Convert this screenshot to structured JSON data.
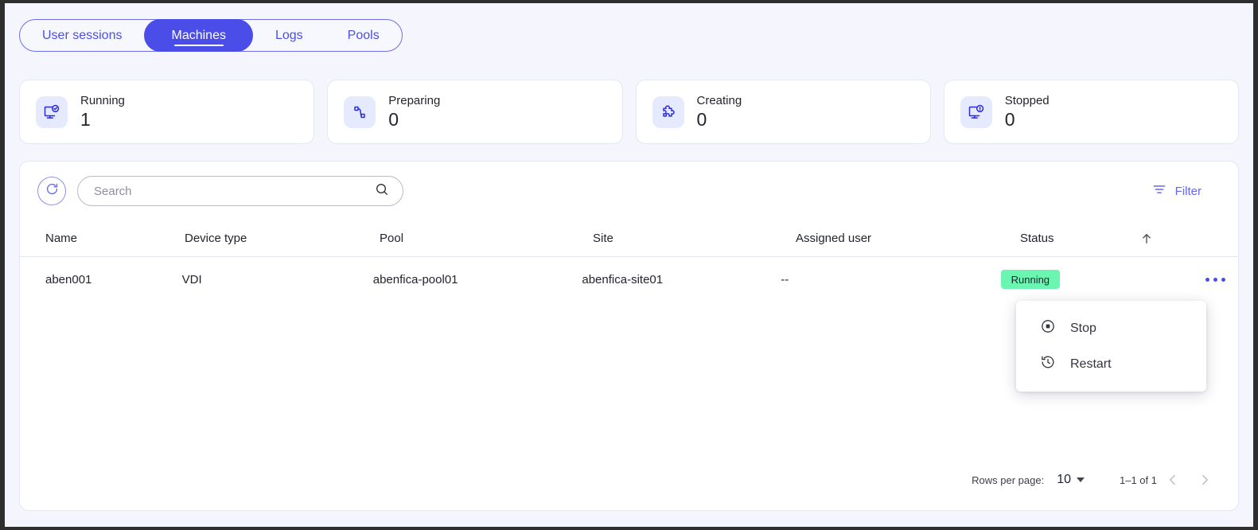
{
  "theme": {
    "accent": "#4b4de8",
    "accent_light": "#6568ef",
    "page_bg": "#f4f5fd",
    "card_bg": "#ffffff",
    "badge_running_bg": "#6af5b0",
    "icon_tile_bg": "#e6eaff"
  },
  "tabs": [
    {
      "label": "User sessions",
      "active": false,
      "name": "tab-user-sessions"
    },
    {
      "label": "Machines",
      "active": true,
      "name": "tab-machines"
    },
    {
      "label": "Logs",
      "active": false,
      "name": "tab-logs"
    },
    {
      "label": "Pools",
      "active": false,
      "name": "tab-pools"
    }
  ],
  "stats": [
    {
      "label": "Running",
      "value": "1",
      "icon": "monitor-check-icon"
    },
    {
      "label": "Preparing",
      "value": "0",
      "icon": "nodes-transfer-icon"
    },
    {
      "label": "Creating",
      "value": "0",
      "icon": "puzzle-piece-icon"
    },
    {
      "label": "Stopped",
      "value": "0",
      "icon": "monitor-alert-icon"
    }
  ],
  "toolbar": {
    "refresh_icon": "refresh-icon",
    "search_placeholder": "Search",
    "search_value": "",
    "search_icon": "search-icon",
    "filter_label": "Filter",
    "filter_icon": "filter-icon"
  },
  "table": {
    "columns": [
      {
        "label": "Name",
        "name": "column-header-name"
      },
      {
        "label": "Device type",
        "name": "column-header-device-type"
      },
      {
        "label": "Pool",
        "name": "column-header-pool"
      },
      {
        "label": "Site",
        "name": "column-header-site"
      },
      {
        "label": "Assigned user",
        "name": "column-header-assigned-user"
      },
      {
        "label": "Status",
        "name": "column-header-status"
      }
    ],
    "sort_indicator": "sort-ascending-icon",
    "rows": [
      {
        "name": "aben001",
        "device_type": "VDI",
        "pool": "abenfica-pool01",
        "site": "abenfica-site01",
        "assigned_user": "--",
        "status": "Running"
      }
    ]
  },
  "context_menu": {
    "visible": true,
    "items": [
      {
        "label": "Stop",
        "icon": "stop-circle-icon"
      },
      {
        "label": "Restart",
        "icon": "restart-clock-icon"
      }
    ]
  },
  "pagination": {
    "rows_per_page_label": "Rows per page:",
    "rows_per_page_value": "10",
    "range_text": "1–1 of 1",
    "prev_icon": "chevron-left-icon",
    "next_icon": "chevron-right-icon"
  }
}
